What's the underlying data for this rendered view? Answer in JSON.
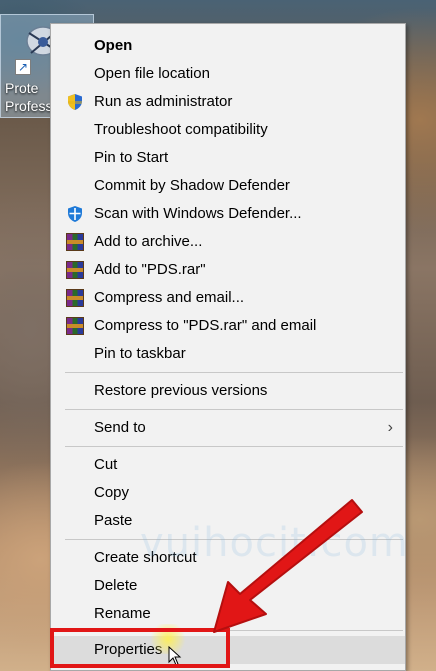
{
  "desktop": {
    "icon_label_line1": "Prote",
    "icon_label_line2": "Profess"
  },
  "menu": {
    "items": [
      {
        "label": "Open",
        "icon": "none",
        "bold": true
      },
      {
        "label": "Open file location",
        "icon": "none"
      },
      {
        "label": "Run as administrator",
        "icon": "uac-shield-icon"
      },
      {
        "label": "Troubleshoot compatibility",
        "icon": "none"
      },
      {
        "label": "Pin to Start",
        "icon": "none"
      },
      {
        "label": "Commit by Shadow Defender",
        "icon": "none"
      },
      {
        "label": "Scan with Windows Defender...",
        "icon": "windows-defender-icon"
      },
      {
        "label": "Add to archive...",
        "icon": "winrar-icon"
      },
      {
        "label": "Add to \"PDS.rar\"",
        "icon": "winrar-icon"
      },
      {
        "label": "Compress and email...",
        "icon": "winrar-icon"
      },
      {
        "label": "Compress to \"PDS.rar\" and email",
        "icon": "winrar-icon"
      },
      {
        "label": "Pin to taskbar",
        "icon": "none"
      },
      {
        "label": "Restore previous versions",
        "icon": "none"
      },
      {
        "label": "Send to",
        "icon": "none",
        "submenu": true
      },
      {
        "label": "Cut",
        "icon": "none"
      },
      {
        "label": "Copy",
        "icon": "none"
      },
      {
        "label": "Paste",
        "icon": "none"
      },
      {
        "label": "Create shortcut",
        "icon": "none"
      },
      {
        "label": "Delete",
        "icon": "none"
      },
      {
        "label": "Rename",
        "icon": "none"
      },
      {
        "label": "Properties",
        "icon": "none",
        "highlighted": true
      }
    ],
    "submenu_chevron": "›"
  },
  "watermark": "vuihocit.com",
  "annotation": {
    "arrow_color": "#e11616",
    "box_color": "#e11616"
  }
}
